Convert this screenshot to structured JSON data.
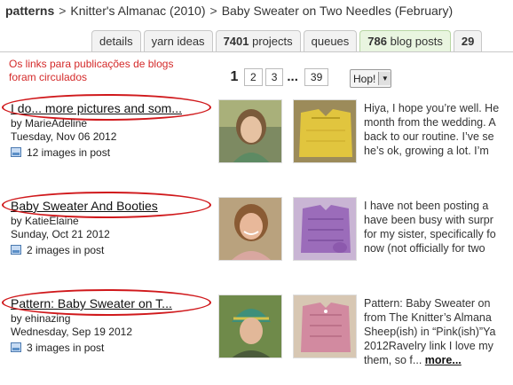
{
  "breadcrumb": {
    "root": "patterns",
    "separator": ">",
    "items": [
      "Knitter's Almanac (2010)",
      "Baby Sweater on Two Needles (February)"
    ]
  },
  "tabs": [
    {
      "label": "details"
    },
    {
      "label": "yarn ideas"
    },
    {
      "count": "7401",
      "label": " projects"
    },
    {
      "label": "queues"
    },
    {
      "count": "786",
      "label": " blog posts",
      "active": true
    },
    {
      "label": "29"
    }
  ],
  "annotation": {
    "note": "Os links para publicações de blogs foram circulados",
    "color": "#d0191c"
  },
  "pagination": {
    "current": "1",
    "pages": [
      "2",
      "3"
    ],
    "ellipsis": "...",
    "last": "39",
    "hop_label": "Hop!"
  },
  "posts": [
    {
      "title": "I do... more pictures and som...",
      "author": "by MarieAdeline",
      "date": "Tuesday, Nov 06 2012",
      "images": "12 images in post",
      "excerpt": [
        "Hiya, I hope you’re well. He",
        "month from the wedding. A",
        "back to our routine. I’ve se",
        "he’s ok, growing a lot. I’m"
      ]
    },
    {
      "title": "Baby Sweater And Booties",
      "author": "by KatieElaine",
      "date": "Sunday, Oct 21 2012",
      "images": "2 images in post",
      "excerpt": [
        "I have not been posting a",
        "have been busy with surpr",
        "for my sister, specifically fo",
        "now (not officially for two"
      ]
    },
    {
      "title": "Pattern: Baby Sweater on T...",
      "author": "by ehinazing",
      "date": "Wednesday, Sep 19 2012",
      "images": "3 images in post",
      "excerpt": [
        "Pattern: Baby Sweater on",
        "from The Knitter’s Almana",
        "Sheep(ish) in “Pink(ish)”Ya",
        "2012Ravelry link I love my"
      ],
      "excerpt_last": "them, so f...",
      "more": "more..."
    }
  ]
}
